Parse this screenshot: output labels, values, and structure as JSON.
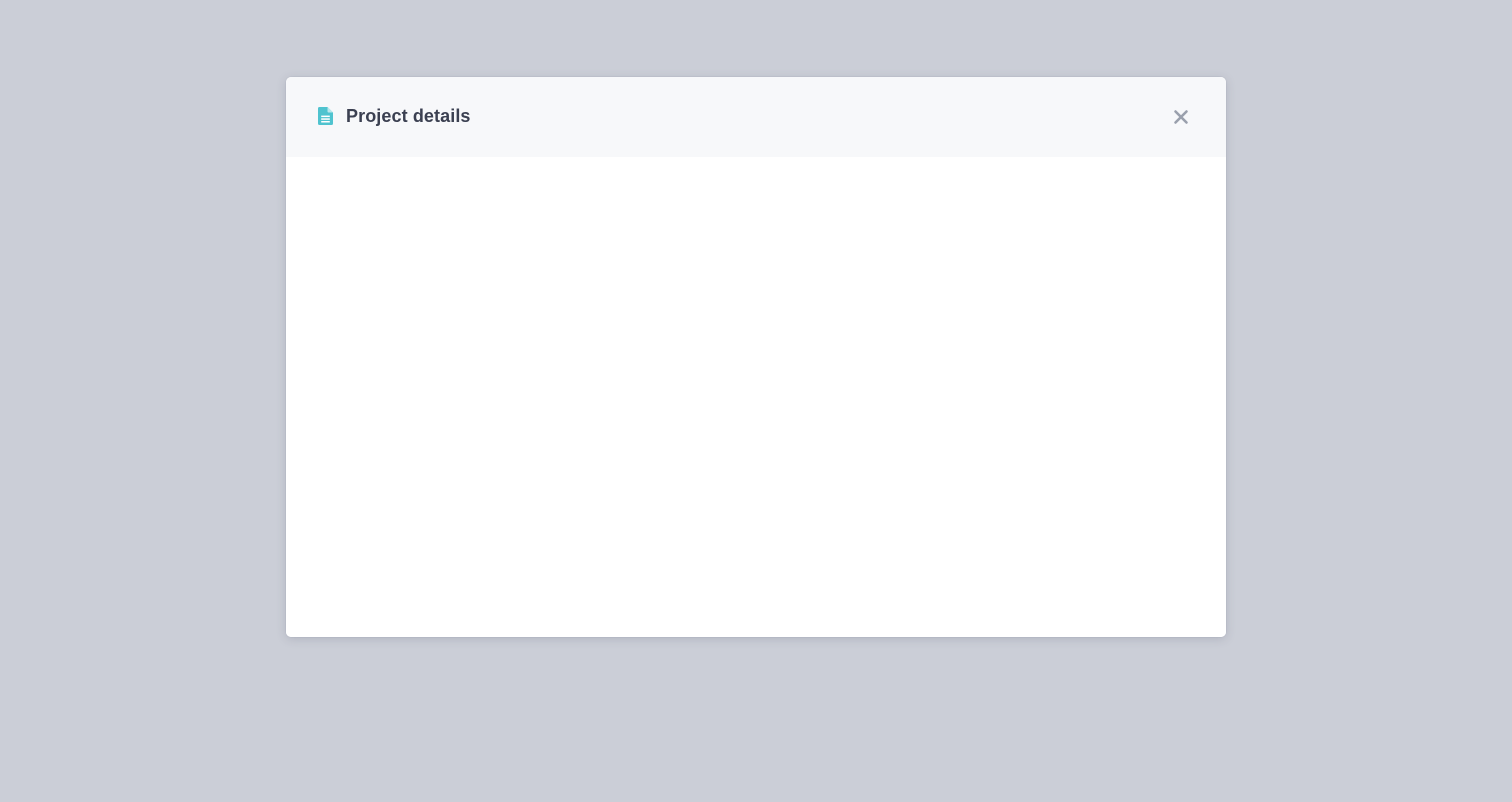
{
  "modal": {
    "title": "Project details",
    "title_icon": "document-icon",
    "close_icon": "close-icon"
  },
  "colors": {
    "backdrop": "#cbced7",
    "header_background": "#f7f8fa",
    "title_text": "#3b4051",
    "icon_accent": "#4fc3cf",
    "close_icon": "#9aa0ad"
  }
}
